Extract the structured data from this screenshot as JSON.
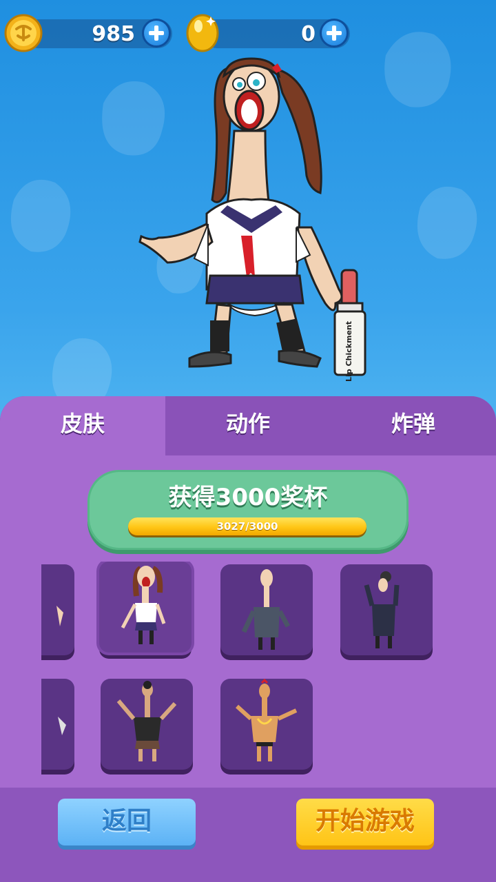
{
  "currency": {
    "trophies": {
      "icon": "trophy-coin-icon",
      "value": "985"
    },
    "coins": {
      "icon": "gold-egg-coin-icon",
      "value": "0"
    }
  },
  "character": {
    "prop_label": "Lip Chickment"
  },
  "tabs": [
    {
      "label": "皮肤",
      "active": true
    },
    {
      "label": "动作",
      "active": false
    },
    {
      "label": "炸弹",
      "active": false
    }
  ],
  "goal": {
    "title": "获得3000奖杯",
    "progress_text": "3027/3000",
    "progress_fraction": 1.0
  },
  "skins": [
    {
      "name": "partial-left-skin-1",
      "selected": false
    },
    {
      "name": "schoolgirl-skin",
      "selected": true
    },
    {
      "name": "suit-skin",
      "selected": false
    },
    {
      "name": "singer-skin",
      "selected": false
    },
    {
      "name": "partial-left-skin-2",
      "selected": false
    },
    {
      "name": "black-shirt-skin",
      "selected": false
    },
    {
      "name": "gold-chain-skin",
      "selected": false
    }
  ],
  "buttons": {
    "back": "返回",
    "start": "开始游戏"
  },
  "colors": {
    "panel": "#a66bd0",
    "tab_bar": "#8a52b8",
    "goal_green": "#6cc89a",
    "progress_yellow": "#ffc515",
    "back_blue": "#5cb2f5",
    "start_yellow": "#ffc416"
  }
}
